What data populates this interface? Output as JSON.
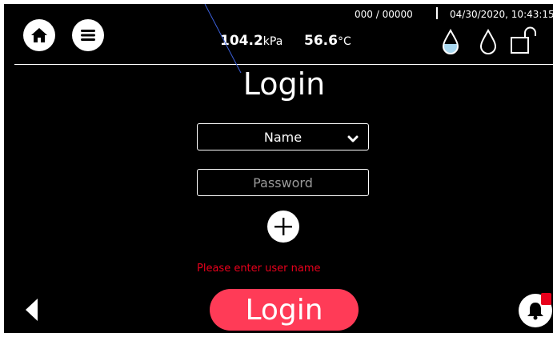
{
  "header": {
    "counter": "000 / 00000",
    "datetime": "04/30/2020, 10:43:15",
    "pressure_value": "104.2",
    "pressure_unit": "kPa",
    "temperature_value": "56.6",
    "temperature_unit": "°C"
  },
  "main": {
    "title": "Login",
    "name_select": {
      "selected": "Name"
    },
    "password": {
      "placeholder": "Password",
      "value": ""
    },
    "error_message": "Please enter user name",
    "login_button": "Login"
  },
  "icons": {
    "home": "home-icon",
    "menu": "menu-icon",
    "water_drop_filled": "water-drop-filled-icon",
    "water_drop_outline": "water-drop-outline-icon",
    "lock_open": "unlock-icon",
    "add": "plus-icon",
    "back": "back-arrow-icon",
    "bell": "bell-icon"
  },
  "colors": {
    "background": "#000000",
    "foreground": "#ffffff",
    "accent": "#ff3b57",
    "error": "#e8001c",
    "drop_fill": "#a9d8f0"
  }
}
